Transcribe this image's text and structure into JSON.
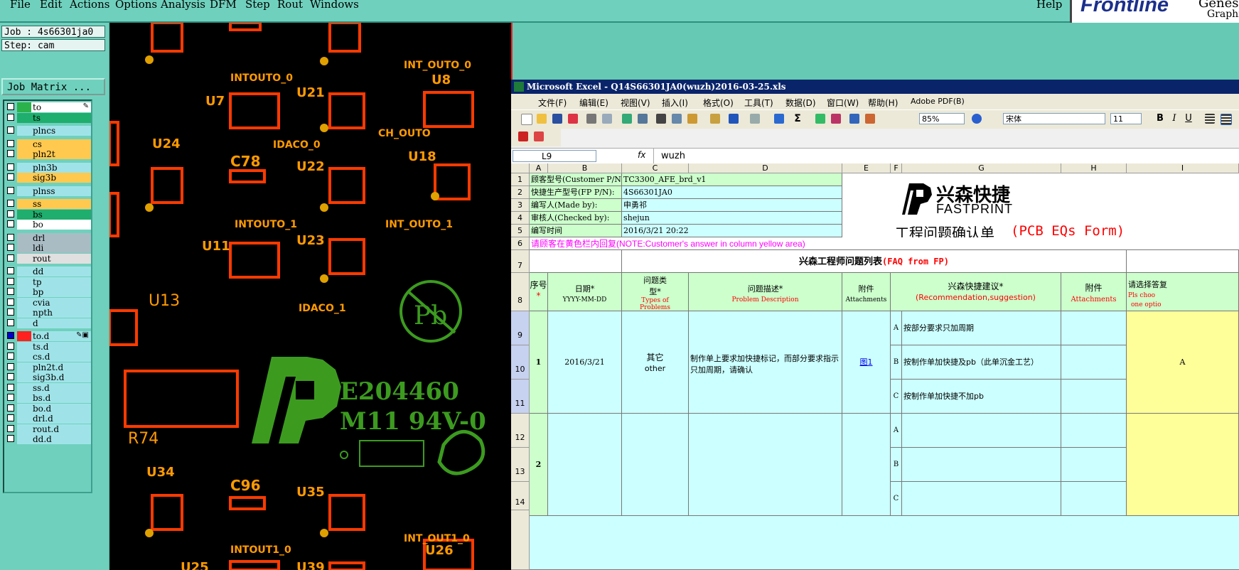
{
  "menubar": {
    "items": [
      "File",
      "Edit",
      "Actions",
      "Options",
      "Analysis",
      "DFM",
      "Step",
      "Rout",
      "Windows"
    ],
    "help": "Help",
    "brand": "Frontline",
    "brand_right_1": "Genes",
    "brand_right_2": "Graphi"
  },
  "leftpanel": {
    "job": "Job : 4s66301ja0",
    "step": "Step: cam",
    "job_matrix": "Job Matrix ..."
  },
  "layers": [
    {
      "name": "to",
      "color": "#ffffff",
      "name_bg": "#ffffff",
      "swatch": "#2bb24a",
      "checked": false,
      "flag": "✎"
    },
    {
      "name": "ts",
      "color": "#ffffff",
      "name_bg": "#1fae6d",
      "swatch": "#1fae6d",
      "checked": false
    },
    {
      "name": "plncs",
      "name_bg": "#9fe3e8",
      "swatch": "#9fe3e8",
      "checked": false
    },
    {
      "name": "cs",
      "name_bg": "#ffc94f",
      "swatch": "#ffc94f",
      "checked": false
    },
    {
      "name": "pln2t",
      "name_bg": "#ffc94f",
      "swatch": "#ffc94f",
      "checked": false
    },
    {
      "name": "pln3b",
      "name_bg": "#9fe3e8",
      "swatch": "#9fe3e8",
      "checked": false
    },
    {
      "name": "sig3b",
      "name_bg": "#ffc94f",
      "swatch": "#ffc94f",
      "checked": false
    },
    {
      "name": "plnss",
      "name_bg": "#9fe3e8",
      "swatch": "#9fe3e8",
      "checked": false
    },
    {
      "name": "ss",
      "name_bg": "#ffc94f",
      "swatch": "#ffc94f",
      "checked": false
    },
    {
      "name": "bs",
      "name_bg": "#1fae6d",
      "swatch": "#1fae6d",
      "checked": false
    },
    {
      "name": "bo",
      "name_bg": "#ffffff",
      "swatch": "#ffffff",
      "checked": false
    },
    {
      "name": "drl",
      "name_bg": "#a9bcc4",
      "swatch": "#a9bcc4",
      "checked": false
    },
    {
      "name": "ldi",
      "name_bg": "#a9bcc4",
      "swatch": "#a9bcc4",
      "checked": false
    },
    {
      "name": "rout",
      "name_bg": "#e0e0e0",
      "swatch": "#e0e0e0",
      "checked": false
    },
    {
      "name": "dd",
      "name_bg": "#9fe3e8",
      "swatch": "#9fe3e8",
      "checked": false
    },
    {
      "name": "tp",
      "name_bg": "#9fe3e8",
      "swatch": "#9fe3e8",
      "checked": false
    },
    {
      "name": "bp",
      "name_bg": "#9fe3e8",
      "swatch": "#9fe3e8",
      "checked": false
    },
    {
      "name": "cvia",
      "name_bg": "#9fe3e8",
      "swatch": "#9fe3e8",
      "checked": false
    },
    {
      "name": "npth",
      "name_bg": "#9fe3e8",
      "swatch": "#9fe3e8",
      "checked": false
    },
    {
      "name": "d",
      "name_bg": "#9fe3e8",
      "swatch": "#9fe3e8",
      "checked": false
    },
    {
      "name": "to.d",
      "name_bg": "#9fe3e8",
      "swatch": "#ff2020",
      "checked": true,
      "flag": "✎▣"
    },
    {
      "name": "ts.d",
      "name_bg": "#9fe3e8",
      "swatch": "#9fe3e8",
      "checked": false
    },
    {
      "name": "cs.d",
      "name_bg": "#9fe3e8",
      "swatch": "#9fe3e8",
      "checked": false
    },
    {
      "name": "pln2t.d",
      "name_bg": "#9fe3e8",
      "swatch": "#9fe3e8",
      "checked": false
    },
    {
      "name": "sig3b.d",
      "name_bg": "#9fe3e8",
      "swatch": "#9fe3e8",
      "checked": false
    },
    {
      "name": "ss.d",
      "name_bg": "#9fe3e8",
      "swatch": "#9fe3e8",
      "checked": false
    },
    {
      "name": "bs.d",
      "name_bg": "#9fe3e8",
      "swatch": "#9fe3e8",
      "checked": false
    },
    {
      "name": "bo.d",
      "name_bg": "#9fe3e8",
      "swatch": "#9fe3e8",
      "checked": false
    },
    {
      "name": "drl.d",
      "name_bg": "#9fe3e8",
      "swatch": "#9fe3e8",
      "checked": false
    },
    {
      "name": "rout.d",
      "name_bg": "#9fe3e8",
      "swatch": "#9fe3e8",
      "checked": false
    },
    {
      "name": "dd.d",
      "name_bg": "#9fe3e8",
      "swatch": "#9fe3e8",
      "checked": false
    }
  ],
  "pcb": {
    "labels": [
      "U7",
      "U21",
      "U8",
      "INTOUTO_0",
      "INT_OUTO_0",
      "U24",
      "IDACO_0",
      "CH_OUTO",
      "U18",
      "C78",
      "U22",
      "INTOUTO_1",
      "INT_OUTO_1",
      "U11",
      "U23",
      "U13",
      "IDACO_1",
      "R74",
      "U34",
      "C96",
      "U35",
      "INTOUT1_0",
      "INT_OUT1_0",
      "U26",
      "U25",
      "U39"
    ],
    "cert_line1": "E204460",
    "cert_line2": "M11 94V-0",
    "pb_mark": "Pb"
  },
  "excel": {
    "title": "Microsoft Excel - Q14S66301JA0(wuzh)2016-03-25.xls",
    "menu": [
      "文件(F)",
      "编辑(E)",
      "视图(V)",
      "插入(I)",
      "格式(O)",
      "工具(T)",
      "数据(D)",
      "窗口(W)",
      "帮助(H)",
      "Adobe PDF(B)"
    ],
    "zoom": "85%",
    "font_name": "宋体",
    "font_size": "11",
    "name_box": "L9",
    "fx": "fx",
    "formula": "wuzh",
    "col_headers": [
      "A",
      "B",
      "C",
      "D",
      "E",
      "F",
      "G",
      "H",
      "I"
    ],
    "rows": {
      "r1_label": "顾客型号(Customer P/N):",
      "r1_value": "TC3300_AFE_brd_v1",
      "r2_label": "快捷生产型号(FP P/N):",
      "r2_value": "4S66301JA0",
      "r3_label": "编写人(Made by):",
      "r3_value": "申勇祁",
      "r4_label": "审核人(Checked by):",
      "r4_value": "shejun",
      "r5_label": "编写时间",
      "r5_value": "2016/3/21 20:22",
      "r6_note_cn": "请顾客在黄色栏内回复",
      "r6_note_en": "(NOTE:Customer's answer in column yellow area)",
      "r7_title": "兴森工程师问题列表",
      "r7_title_en": "(FAQ from FP)"
    },
    "brand": {
      "cn": "兴森快捷",
      "en": "FASTPRINT",
      "form_title": "工程问题确认单",
      "form_title_en": "(PCB EQs Form)"
    },
    "header_row8": {
      "seq": "序号",
      "date": "日期*",
      "date_fmt": "YYYY-MM-DD",
      "type": "问题类型*",
      "type_en": "Types of Problems",
      "desc": "问题描述*",
      "desc_en": "Problem Description",
      "attach": "附件",
      "attach_en": "Attachments",
      "suggest": "兴森快捷建议*",
      "suggest_en": "(Recommendation,suggestion)",
      "attach2": "附件",
      "attach2_en": "Attachments",
      "answer": "请选择答复",
      "answer_en1": "Pls choo",
      "answer_en2": "one optio"
    },
    "issue1": {
      "no": "1",
      "date": "2016/3/21",
      "type": "其它",
      "type_en": "other",
      "desc_1": "制作单上要求加快捷标记，而部分要求指示",
      "desc_2": "只加周期，请确认",
      "attach": "图1",
      "opt_a": "A",
      "opt_a_text": "按部分要求只加周期",
      "opt_b": "B",
      "opt_b_text": "按制作单加快捷及pb（此单沉金工艺）",
      "opt_c": "C",
      "opt_c_text": "按制作单加快捷不加pb",
      "answer": "A"
    },
    "issue2": {
      "no": "2",
      "opt_a": "A",
      "opt_b": "B",
      "opt_c": "C"
    },
    "row_numbers": [
      "1",
      "2",
      "3",
      "4",
      "5",
      "6",
      "7",
      "8",
      "9",
      "10",
      "11",
      "12",
      "13",
      "14"
    ]
  }
}
